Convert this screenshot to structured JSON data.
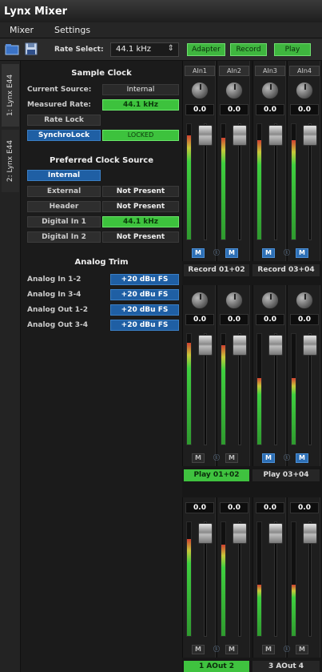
{
  "window": {
    "title": "Lynx Mixer"
  },
  "menu": {
    "items": [
      "Mixer",
      "Settings"
    ]
  },
  "toolbar": {
    "rate_label": "Rate Select:",
    "rate_value": "44.1 kHz",
    "buttons": [
      "Adapter",
      "Record",
      "Play"
    ]
  },
  "tabs": [
    "1: Lynx E44",
    "2: Lynx E44"
  ],
  "sample_clock": {
    "title": "Sample Clock",
    "current_source_label": "Current Source:",
    "current_source_value": "Internal",
    "measured_rate_label": "Measured Rate:",
    "measured_rate_value": "44.1 kHz",
    "rate_lock_label": "Rate Lock",
    "synchrolock_label": "SynchroLock",
    "synchrolock_value": "LOCKED"
  },
  "preferred_clock": {
    "title": "Preferred Clock Source",
    "sources": [
      {
        "name": "Internal",
        "status": "",
        "active": true
      },
      {
        "name": "External",
        "status": "Not Present",
        "active": false
      },
      {
        "name": "Header",
        "status": "Not Present",
        "active": false
      },
      {
        "name": "Digital In 1",
        "status": "44.1 kHz",
        "active": false
      },
      {
        "name": "Digital In 2",
        "status": "Not Present",
        "active": false
      }
    ]
  },
  "analog_trim": {
    "title": "Analog Trim",
    "rows": [
      {
        "label": "Analog In 1-2",
        "value": "+20 dBu FS"
      },
      {
        "label": "Analog In 3-4",
        "value": "+20 dBu FS"
      },
      {
        "label": "Analog Out 1-2",
        "value": "+20 dBu FS"
      },
      {
        "label": "Analog Out 3-4",
        "value": "+20 dBu FS"
      }
    ]
  },
  "mixer": {
    "inputs": [
      "AIn1",
      "AIn2",
      "AIn3",
      "AIn4"
    ],
    "record_values": [
      "0.0",
      "0.0",
      "0.0",
      "0.0"
    ],
    "record_groups": [
      "Record 01+02",
      "Record 03+04"
    ],
    "play_values": [
      "0.0",
      "0.0",
      "0.0",
      "0.0"
    ],
    "play_groups": [
      "Play 01+02",
      "Play 03+04"
    ],
    "out_values": [
      "0.0",
      "0.0",
      "0.0",
      "0.0"
    ],
    "out_groups": [
      "1  AOut  2",
      "3  AOut  4"
    ],
    "mute_label": "M",
    "link_glyph": "ⓛ",
    "record_meter_levels": [
      0.9,
      0.88,
      0.86,
      0.86
    ],
    "play_meter_levels": [
      0.92,
      0.9,
      0.6,
      0.6
    ],
    "out_meter_levels": [
      0.85,
      0.8,
      0.45,
      0.45
    ]
  }
}
